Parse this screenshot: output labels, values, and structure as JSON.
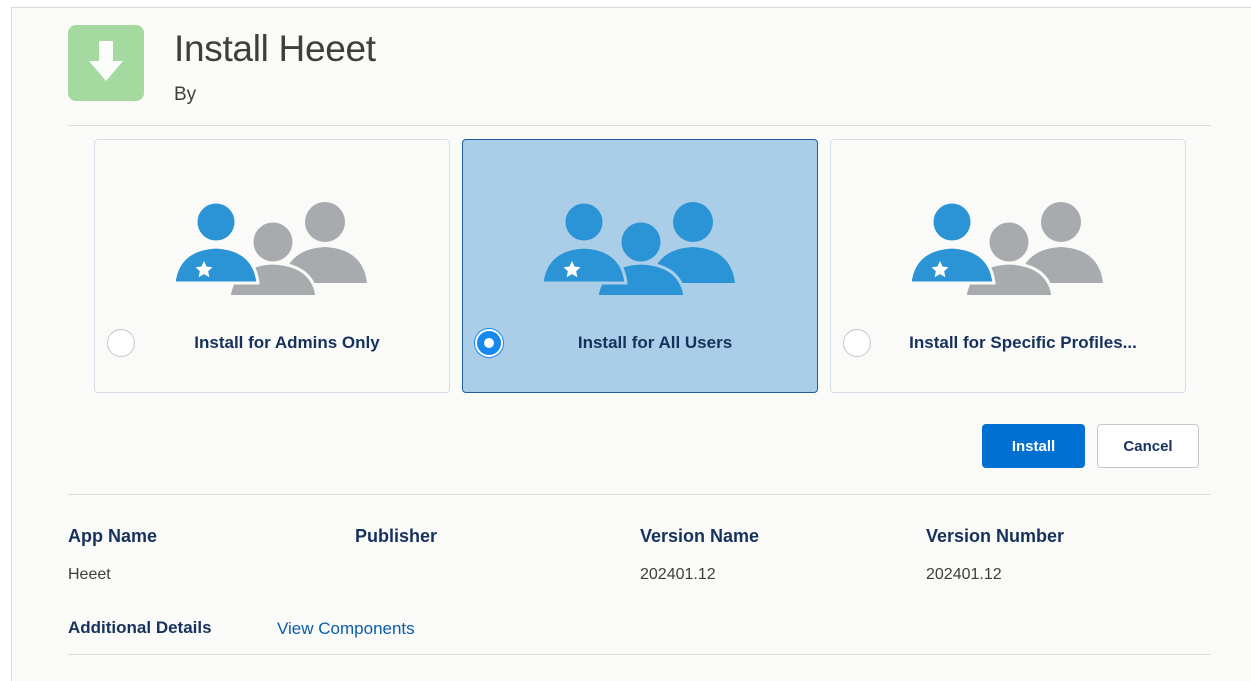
{
  "header": {
    "title": "Install Heeet",
    "subtitle": "By",
    "app_icon": "download-arrow-icon"
  },
  "options": [
    {
      "label": "Install for Admins Only",
      "icon": "admin-users-icon",
      "selected": false
    },
    {
      "label": "Install for All Users",
      "icon": "all-users-icon",
      "selected": true
    },
    {
      "label": "Install for Specific Profiles...",
      "icon": "specific-profiles-icon",
      "selected": false
    }
  ],
  "actions": {
    "install_label": "Install",
    "cancel_label": "Cancel"
  },
  "details": {
    "columns": [
      {
        "heading": "App Name",
        "value": "Heeet"
      },
      {
        "heading": "Publisher",
        "value": ""
      },
      {
        "heading": "Version Name",
        "value": "202401.12"
      },
      {
        "heading": "Version Number",
        "value": "202401.12"
      }
    ],
    "additional_label": "Additional Details",
    "view_components_link": "View Components"
  },
  "colors": {
    "accent_blue": "#0070d2",
    "selected_bg": "#aacde8",
    "icon_green": "#a4d9a0",
    "person_blue": "#2a94d6",
    "person_gray": "#a8abae"
  }
}
